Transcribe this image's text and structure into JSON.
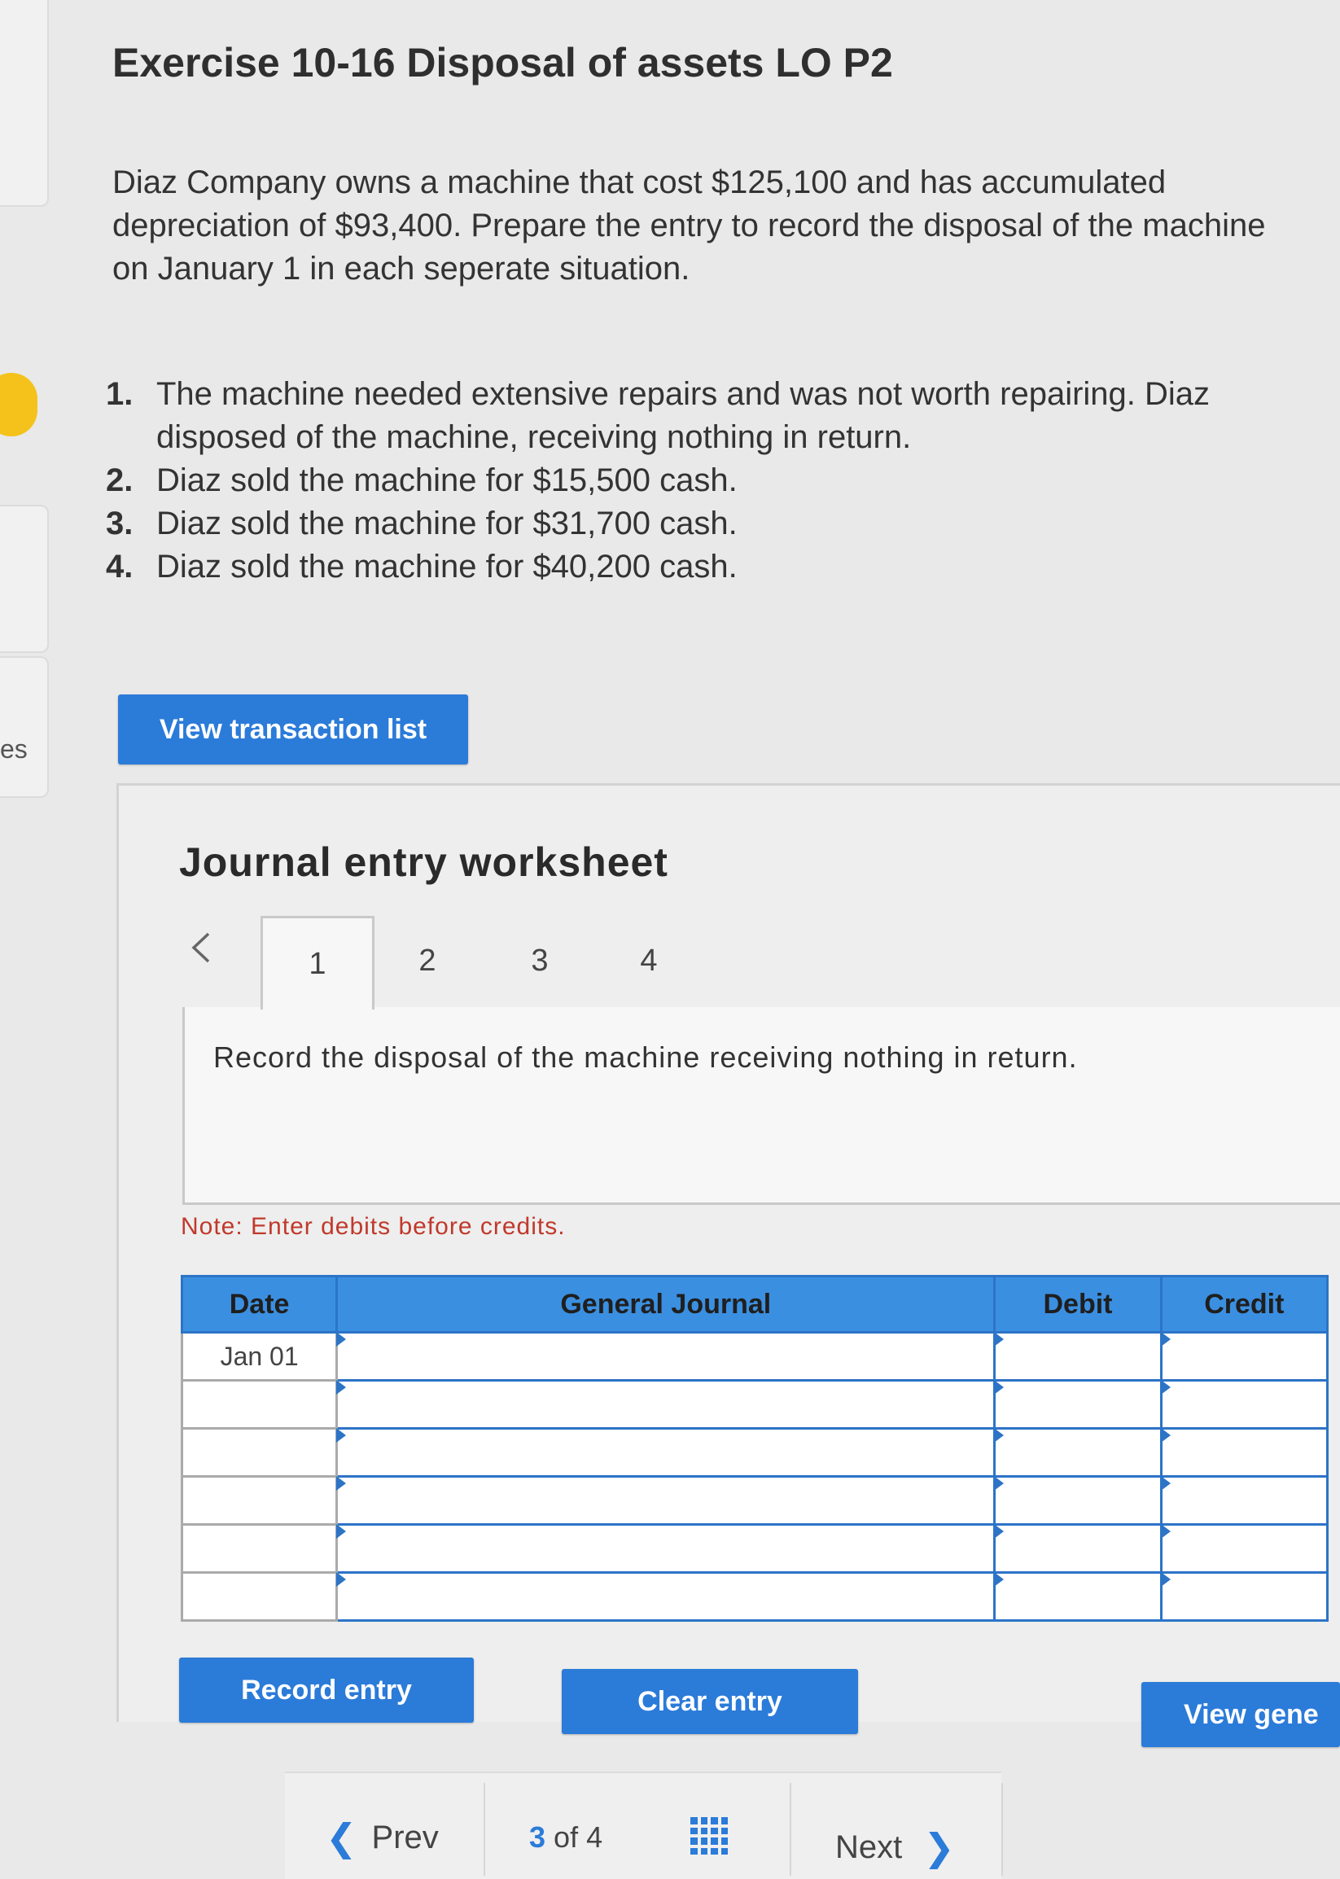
{
  "sidebar": {
    "partial_label": "es"
  },
  "exercise": {
    "title": "Exercise 10-16 Disposal of assets LO P2",
    "intro": "Diaz Company owns a machine that cost $125,100 and has accumulated depreciation of $93,400. Prepare the entry to record the disposal of the machine on January 1 in each seperate situation.",
    "requirements": [
      {
        "num": "1.",
        "text": "The machine needed extensive repairs and was not worth repairing. Diaz disposed of the machine, receiving nothing in return."
      },
      {
        "num": "2.",
        "text": "Diaz sold the machine for $15,500 cash."
      },
      {
        "num": "3.",
        "text": "Diaz sold the machine for $31,700 cash."
      },
      {
        "num": "4.",
        "text": "Diaz sold the machine for $40,200 cash."
      }
    ]
  },
  "buttons": {
    "view_transaction_list": "View transaction list",
    "record_entry": "Record entry",
    "clear_entry": "Clear entry",
    "view_general_journal": "View gene"
  },
  "worksheet": {
    "title": "Journal entry worksheet",
    "prev_tab_icon": "chevron-left-icon",
    "tabs": [
      "1",
      "2",
      "3",
      "4"
    ],
    "active_tab": "1",
    "instruction": "Record the disposal of the machine receiving nothing in return.",
    "note": "Note: Enter debits before credits."
  },
  "journal": {
    "headers": {
      "date": "Date",
      "account": "General Journal",
      "debit": "Debit",
      "credit": "Credit"
    },
    "rows": [
      {
        "date": "Jan 01",
        "account": "",
        "debit": "",
        "credit": ""
      },
      {
        "date": "",
        "account": "",
        "debit": "",
        "credit": ""
      },
      {
        "date": "",
        "account": "",
        "debit": "",
        "credit": ""
      },
      {
        "date": "",
        "account": "",
        "debit": "",
        "credit": ""
      },
      {
        "date": "",
        "account": "",
        "debit": "",
        "credit": ""
      },
      {
        "date": "",
        "account": "",
        "debit": "",
        "credit": ""
      }
    ]
  },
  "pagination": {
    "prev_label": "Prev",
    "current": "3",
    "of_label": "of",
    "total": "4",
    "next_label": "Next",
    "grid_icon": "grid-icon"
  },
  "colors": {
    "accent": "#2b7bd9",
    "note": "#c0392b",
    "badge": "#f4c21b"
  }
}
